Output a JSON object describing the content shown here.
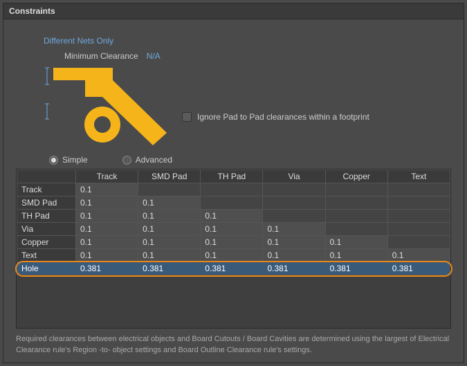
{
  "panel": {
    "title": "Constraints"
  },
  "diffNets": "Different Nets Only",
  "minClearance": {
    "label": "Minimum Clearance",
    "value": "N/A"
  },
  "ignorePad": {
    "label": "Ignore Pad to Pad clearances within a footprint"
  },
  "mode": {
    "simple": "Simple",
    "advanced": "Advanced"
  },
  "table": {
    "headers": [
      "Track",
      "SMD Pad",
      "TH Pad",
      "Via",
      "Copper",
      "Text"
    ],
    "rows": [
      {
        "label": "Track",
        "cells": [
          "0.1",
          "",
          "",
          "",
          "",
          ""
        ]
      },
      {
        "label": "SMD Pad",
        "cells": [
          "0.1",
          "0.1",
          "",
          "",
          "",
          ""
        ]
      },
      {
        "label": "TH Pad",
        "cells": [
          "0.1",
          "0.1",
          "0.1",
          "",
          "",
          ""
        ]
      },
      {
        "label": "Via",
        "cells": [
          "0.1",
          "0.1",
          "0.1",
          "0.1",
          "",
          ""
        ]
      },
      {
        "label": "Copper",
        "cells": [
          "0.1",
          "0.1",
          "0.1",
          "0.1",
          "0.1",
          ""
        ]
      },
      {
        "label": "Text",
        "cells": [
          "0.1",
          "0.1",
          "0.1",
          "0.1",
          "0.1",
          "0.1"
        ]
      },
      {
        "label": "Hole",
        "cells": [
          "0.381",
          "0.381",
          "0.381",
          "0.381",
          "0.381",
          "0.381"
        ],
        "highlighted": true
      }
    ]
  },
  "footer": "Required clearances between electrical objects and Board Cutouts / Board Cavities are determined using the largest of Electrical Clearance rule's Region -to- object settings and Board Outline Clearance rule's settings.",
  "chart_data": {
    "type": "table",
    "title": "Clearance Matrix",
    "columns": [
      "Track",
      "SMD Pad",
      "TH Pad",
      "Via",
      "Copper",
      "Text"
    ],
    "rows": [
      "Track",
      "SMD Pad",
      "TH Pad",
      "Via",
      "Copper",
      "Text",
      "Hole"
    ],
    "values": [
      [
        0.1,
        null,
        null,
        null,
        null,
        null
      ],
      [
        0.1,
        0.1,
        null,
        null,
        null,
        null
      ],
      [
        0.1,
        0.1,
        0.1,
        null,
        null,
        null
      ],
      [
        0.1,
        0.1,
        0.1,
        0.1,
        null,
        null
      ],
      [
        0.1,
        0.1,
        0.1,
        0.1,
        0.1,
        null
      ],
      [
        0.1,
        0.1,
        0.1,
        0.1,
        0.1,
        0.1
      ],
      [
        0.381,
        0.381,
        0.381,
        0.381,
        0.381,
        0.381
      ]
    ]
  }
}
